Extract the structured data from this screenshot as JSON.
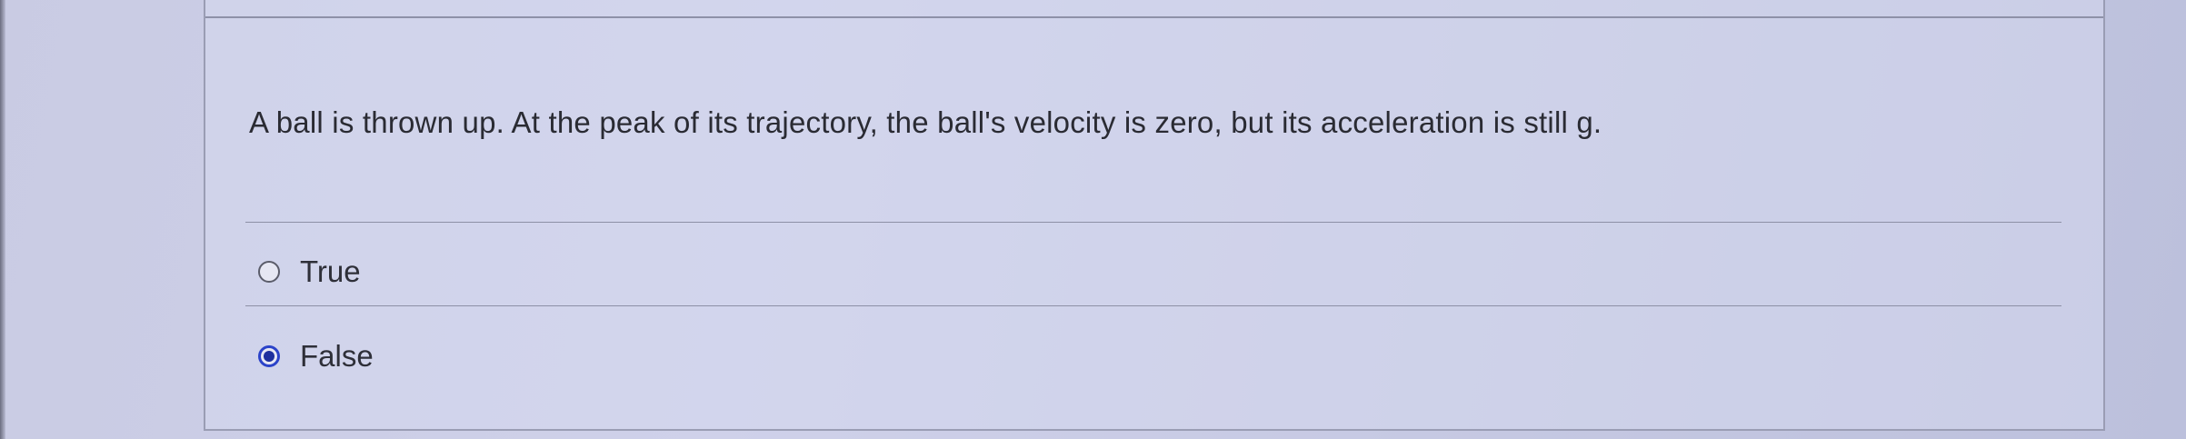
{
  "question": {
    "text": "A ball is thrown up. At the peak of its trajectory, the ball's velocity is zero, but its acceleration is still g."
  },
  "options": [
    {
      "label": "True",
      "selected": false
    },
    {
      "label": "False",
      "selected": true
    }
  ],
  "colors": {
    "selected_radio": "#1d2f9e",
    "background": "#c9cbe3"
  }
}
